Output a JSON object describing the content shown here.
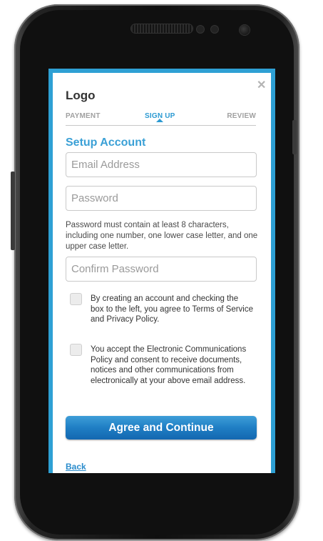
{
  "header": {
    "logo": "Logo",
    "close_glyph": "✕"
  },
  "steps": [
    {
      "label": "PAYMENT",
      "active": false
    },
    {
      "label": "SIGN UP",
      "active": true
    },
    {
      "label": "REVIEW",
      "active": false
    }
  ],
  "form": {
    "heading": "Setup  Account",
    "email": {
      "value": "",
      "placeholder": "Email Address"
    },
    "password": {
      "value": "",
      "placeholder": "Password"
    },
    "password_hint": "Password must contain at least 8 characters, including one number, one lower case letter, and one upper case letter.",
    "confirm": {
      "value": "",
      "placeholder": "Confirm Password"
    },
    "terms": {
      "checked": false,
      "text_prefix": "By creating an account and checking the box to the left, you agree to ",
      "tos_link": "Terms of Service",
      "and": " and ",
      "privacy_link": "Privacy Policy",
      "suffix": "."
    },
    "econsent": {
      "checked": false,
      "text": "You accept the Electronic Communications Policy and consent to receive documents, notices and other communications from electronically at your above email address."
    },
    "submit_label": "Agree and Continue",
    "back_label": "Back"
  },
  "colors": {
    "accent": "#2c9ad2",
    "screen_bg": "#2ea0d4",
    "button": "#1f7ec4"
  }
}
